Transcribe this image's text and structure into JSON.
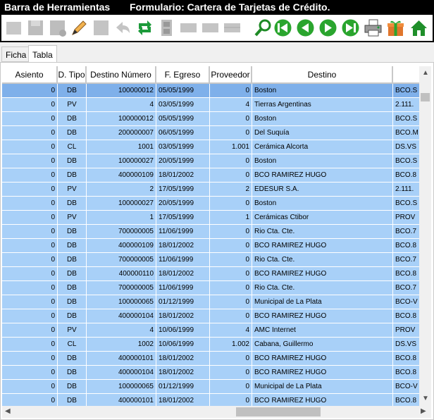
{
  "window": {
    "toolbar_label": "Barra de Herramientas",
    "form_title": "Formulario: Cartera de Tarjetas de Crédito."
  },
  "toolbar": {
    "icons": [
      "disabled-first-icon",
      "save-icon",
      "save-disabled-icon",
      "edit-pencil-icon",
      "save-gray-icon",
      "undo-gray-icon",
      "refresh-green-icon",
      "film-icon",
      "grid-gray-icon",
      "grid-gray-icon",
      "grid-gray-icon",
      "search-magnifier-icon",
      "first-record-icon",
      "previous-record-icon",
      "next-record-icon",
      "last-record-icon",
      "printer-icon",
      "gift-icon",
      "home-icon"
    ]
  },
  "tabs": [
    {
      "label": "Ficha",
      "active": false
    },
    {
      "label": "Tabla",
      "active": true
    }
  ],
  "table": {
    "columns": [
      "Asiento",
      "D. Tipo",
      "Destino Número",
      "F. Egreso",
      "Proveedor",
      "Destino",
      ""
    ],
    "rows": [
      [
        "0",
        "DB",
        "100000012",
        "05/05/1999",
        "0",
        "Boston",
        "BCO.S"
      ],
      [
        "0",
        "PV",
        "4",
        "03/05/1999",
        "4",
        "Tierras Argentinas",
        "2.111."
      ],
      [
        "0",
        "DB",
        "100000012",
        "05/05/1999",
        "0",
        "Boston",
        "BCO.S"
      ],
      [
        "0",
        "DB",
        "200000007",
        "06/05/1999",
        "0",
        "Del Suquía",
        "BCO.M"
      ],
      [
        "0",
        "CL",
        "1001",
        "03/05/1999",
        "1.001",
        "Cerámica Alcorta",
        "DS.VS"
      ],
      [
        "0",
        "DB",
        "100000027",
        "20/05/1999",
        "0",
        "Boston",
        "BCO.S"
      ],
      [
        "0",
        "DB",
        "400000109",
        "18/01/2002",
        "0",
        "BCO RAMIREZ HUGO",
        "BCO.8"
      ],
      [
        "0",
        "PV",
        "2",
        "17/05/1999",
        "2",
        "EDESUR S.A.",
        "2.111."
      ],
      [
        "0",
        "DB",
        "100000027",
        "20/05/1999",
        "0",
        "Boston",
        "BCO.S"
      ],
      [
        "0",
        "PV",
        "1",
        "17/05/1999",
        "1",
        "Cerámicas Ctibor",
        "PROV"
      ],
      [
        "0",
        "DB",
        "700000005",
        "11/06/1999",
        "0",
        "Rio Cta. Cte.",
        "BCO.7"
      ],
      [
        "0",
        "DB",
        "400000109",
        "18/01/2002",
        "0",
        "BCO RAMIREZ HUGO",
        "BCO.8"
      ],
      [
        "0",
        "DB",
        "700000005",
        "11/06/1999",
        "0",
        "Rio Cta. Cte.",
        "BCO.7"
      ],
      [
        "0",
        "DB",
        "400000110",
        "18/01/2002",
        "0",
        "BCO RAMIREZ HUGO",
        "BCO.8"
      ],
      [
        "0",
        "DB",
        "700000005",
        "11/06/1999",
        "0",
        "Rio Cta. Cte.",
        "BCO.7"
      ],
      [
        "0",
        "DB",
        "100000065",
        "01/12/1999",
        "0",
        "Municipal de La Plata",
        "BCO-V"
      ],
      [
        "0",
        "DB",
        "400000104",
        "18/01/2002",
        "0",
        "BCO RAMIREZ HUGO",
        "BCO.8"
      ],
      [
        "0",
        "PV",
        "4",
        "10/06/1999",
        "4",
        "AMC Internet",
        "PROV"
      ],
      [
        "0",
        "CL",
        "1002",
        "10/06/1999",
        "1.002",
        "Cabana, Guillermo",
        "DS.VS"
      ],
      [
        "0",
        "DB",
        "400000101",
        "18/01/2002",
        "0",
        "BCO RAMIREZ HUGO",
        "BCO.8"
      ],
      [
        "0",
        "DB",
        "400000104",
        "18/01/2002",
        "0",
        "BCO RAMIREZ HUGO",
        "BCO.8"
      ],
      [
        "0",
        "DB",
        "100000065",
        "01/12/1999",
        "0",
        "Municipal de La Plata",
        "BCO-V"
      ],
      [
        "0",
        "DB",
        "400000101",
        "18/01/2002",
        "0",
        "BCO RAMIREZ HUGO",
        "BCO.8"
      ]
    ],
    "selected_row": 0
  },
  "colors": {
    "row": "#a8d0f8",
    "selected_row": "#7fb0ea",
    "title_bg": "#000000"
  }
}
